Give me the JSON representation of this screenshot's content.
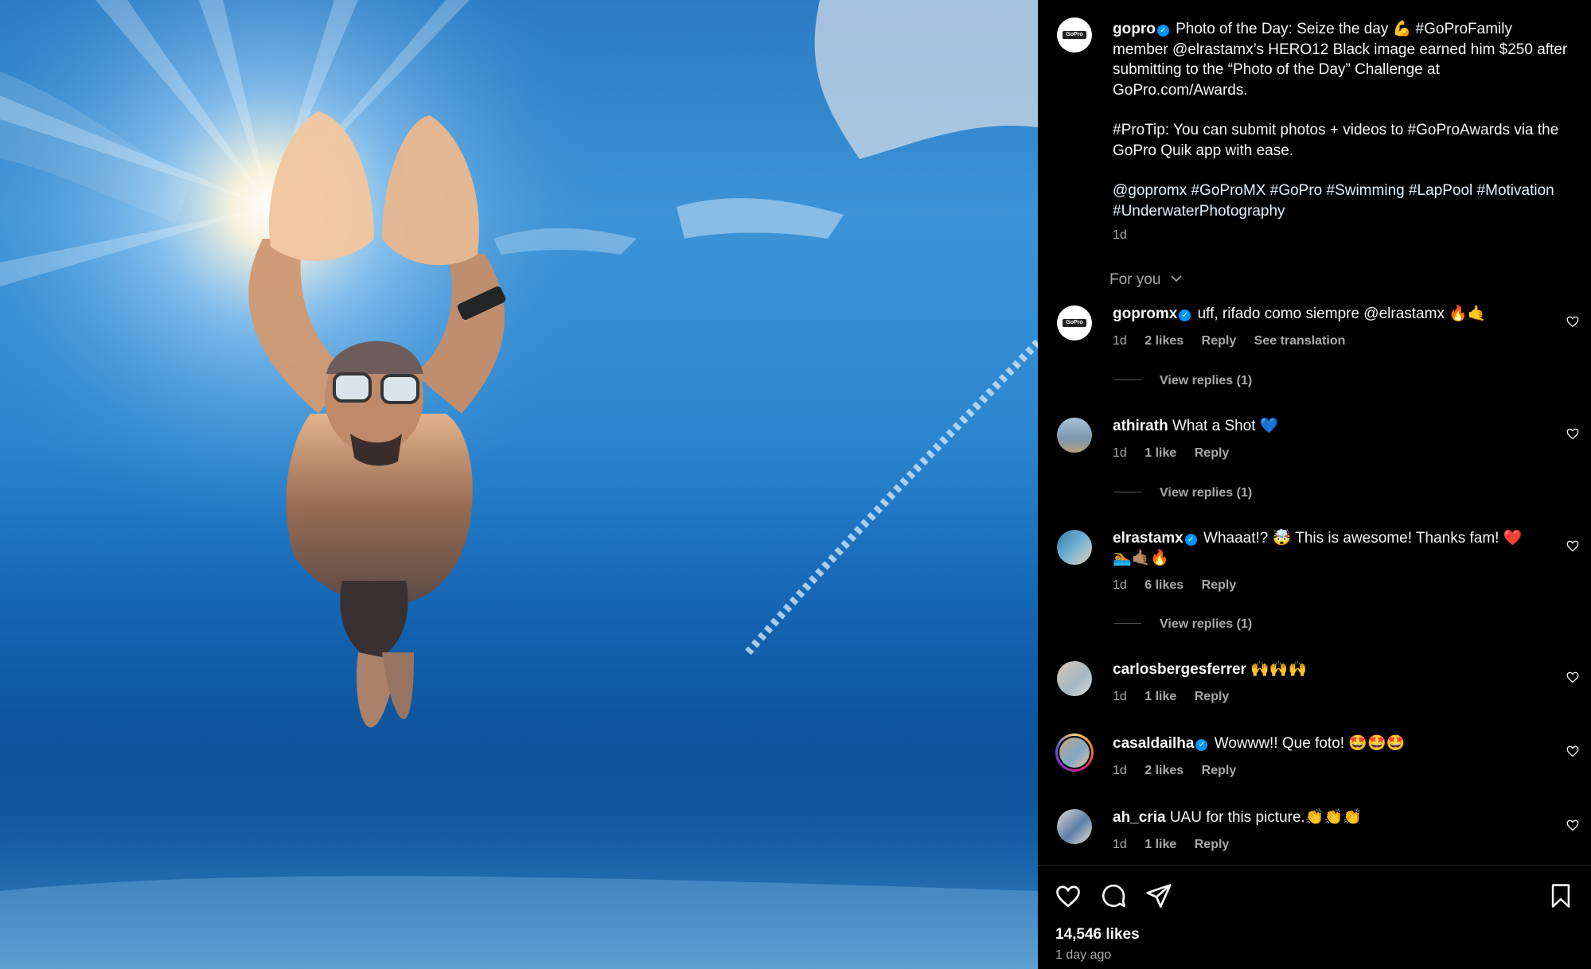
{
  "post": {
    "author": "gopro",
    "caption_lines": {
      "p1": "Photo of the Day: Seize the day 💪 #GoProFamily member @elrastamx’s HERO12 Black image earned him $250 after submitting to the “Photo of the Day” Challenge at GoPro.com/Awards.",
      "p2": "#ProTip: You can submit photos + videos to #GoProAwards via the GoPro Quik app with ease.",
      "p3": "@gopromx #GoProMX #GoPro #Swimming #LapPool #Motivation #UnderwaterPhotography"
    },
    "time": "1d",
    "sort_label": "For you",
    "logo_text": "GoPro"
  },
  "comments": [
    {
      "user": "gopromx",
      "verified": true,
      "text": "uff, rifado como siempre @elrastamx 🔥🤙",
      "time": "1d",
      "likes": "2 likes",
      "reply": "Reply",
      "extra": "See translation",
      "replies": "View replies (1)"
    },
    {
      "user": "athirath",
      "verified": false,
      "text": "What a Shot 💙",
      "time": "1d",
      "likes": "1 like",
      "reply": "Reply",
      "replies": "View replies (1)"
    },
    {
      "user": "elrastamx",
      "verified": true,
      "text": "Whaaat!? 🤯 This is awesome! Thanks fam! ❤️ 🏊🏽🤙🏽🔥",
      "time": "1d",
      "likes": "6 likes",
      "reply": "Reply",
      "replies": "View replies (1)"
    },
    {
      "user": "carlosbergesferrer",
      "verified": false,
      "text": "🙌🙌🙌",
      "time": "1d",
      "likes": "1 like",
      "reply": "Reply"
    },
    {
      "user": "casaldailha",
      "verified": true,
      "text": "Wowww!! Que foto! 🤩🤩🤩",
      "time": "1d",
      "likes": "2 likes",
      "reply": "Reply"
    },
    {
      "user": "ah_cria",
      "verified": false,
      "text": "UAU for this picture.👏👏👏",
      "time": "1d",
      "likes": "1 like",
      "reply": "Reply"
    }
  ],
  "footer": {
    "likes": "14,546 likes",
    "time_ago": "1 day ago"
  },
  "icons": {
    "like": "heart-icon",
    "comment": "comment-icon",
    "share": "send-icon",
    "save": "bookmark-icon",
    "verified": "verified-badge-icon"
  },
  "colors": {
    "background": "#000000",
    "text": "#f5f5f5",
    "muted": "#a8a8a8",
    "verified": "#0095f6"
  }
}
